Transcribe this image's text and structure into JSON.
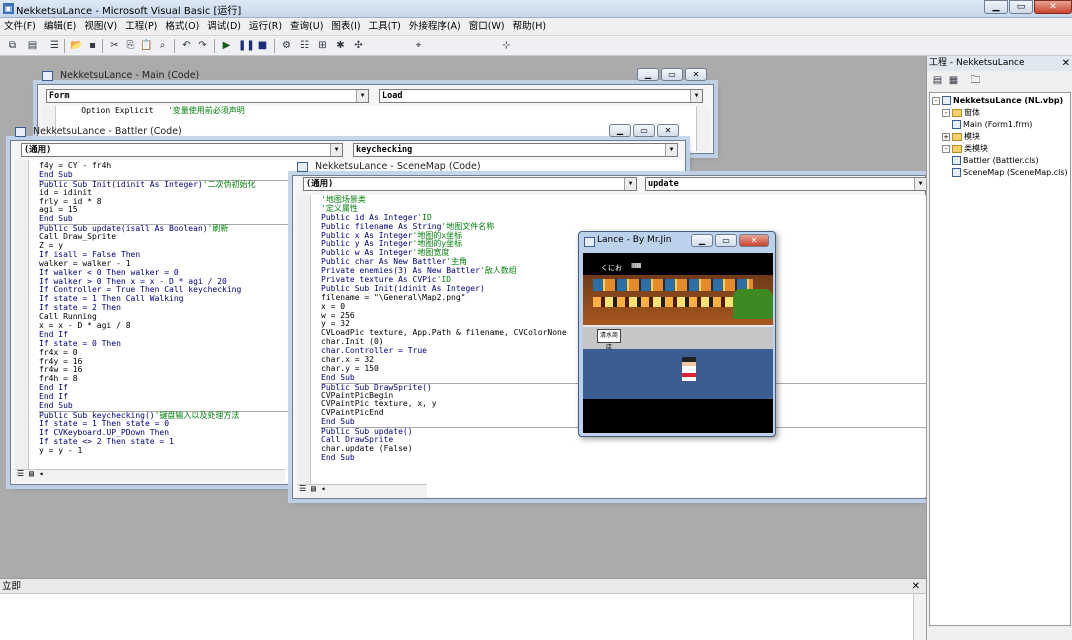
{
  "app": {
    "title": "NekketsuLance - Microsoft Visual Basic [运行]"
  },
  "menu": [
    "文件(F)",
    "编辑(E)",
    "视图(V)",
    "工程(P)",
    "格式(O)",
    "调试(D)",
    "运行(R)",
    "查询(U)",
    "图表(I)",
    "工具(T)",
    "外接程序(A)",
    "窗口(W)",
    "帮助(H)"
  ],
  "windows": {
    "main": {
      "title": "NekketsuLance - Main (Code)",
      "object": "Form",
      "proc": "Load",
      "lines": [
        {
          "t": "    Option Explicit   ",
          "c": "'变量使用前必须声明"
        }
      ]
    },
    "battler": {
      "title": "NekketsuLance - Battler (Code)",
      "object": "(通用)",
      "proc": "keychecking",
      "lines": [
        {
          "t": "f4y = CY - fr4h"
        },
        {
          "t": "End Sub",
          "k": 1
        },
        {
          "t": "Public Sub Init(idinit As Integer)",
          "k": 1,
          "c": "'二次伪初始化"
        },
        {
          "t": "id = idinit"
        },
        {
          "t": "frly = id * 8"
        },
        {
          "t": "agi = 15"
        },
        {
          "t": "End Sub",
          "k": 1
        },
        {
          "t": "Public Sub update(isall As Boolean)",
          "k": 1,
          "c": "'刷新"
        },
        {
          "t": "Call Draw_Sprite"
        },
        {
          "t": "Z = y"
        },
        {
          "t": "If isall = False Then",
          "k": 1
        },
        {
          "t": "walker = walker - 1"
        },
        {
          "t": "If walker < 0 Then walker = 0",
          "k": 1
        },
        {
          "t": "If walker > 0 Then x = x - D * agi / 20",
          "k": 1
        },
        {
          "t": "If Controller = True Then Call keychecking",
          "k": 1
        },
        {
          "t": "If state = 1 Then Call Walking",
          "k": 1
        },
        {
          "t": "If state = 2 Then",
          "k": 1
        },
        {
          "t": "Call Running"
        },
        {
          "t": "x = x - D * agi / 8"
        },
        {
          "t": "End If",
          "k": 1
        },
        {
          "t": "If state = 0 Then",
          "k": 1
        },
        {
          "t": "fr4x = 0"
        },
        {
          "t": "fr4y = 16"
        },
        {
          "t": "fr4w = 16"
        },
        {
          "t": "fr4h = 8"
        },
        {
          "t": "End If",
          "k": 1
        },
        {
          "t": "End If",
          "k": 1
        },
        {
          "t": "End Sub",
          "k": 1
        },
        {
          "t": "Public Sub keychecking()",
          "k": 1,
          "c": "'键盘输入以及处理方法"
        },
        {
          "t": "If state = 1 Then state = 0",
          "k": 1
        },
        {
          "t": "If CVKeyboard.UP_PDown Then",
          "k": 1
        },
        {
          "t": "If state <> 2 Then state = 1",
          "k": 1
        },
        {
          "t": "y = y - 1"
        }
      ]
    },
    "scene": {
      "title": "NekketsuLance - SceneMap (Code)",
      "object": "(通用)",
      "proc": "update",
      "lines": [
        {
          "t": "",
          "c": "'地图场景类"
        },
        {
          "t": "",
          "c": "'定义属性"
        },
        {
          "t": "Public id As Integer",
          "k": 1,
          "c": "'ID"
        },
        {
          "t": "Public filename As String",
          "k": 1,
          "c": "'地图文件名称"
        },
        {
          "t": "Public x As Integer",
          "k": 1,
          "c": "'地图的x坐标"
        },
        {
          "t": "Public y As Integer",
          "k": 1,
          "c": "'地图的y坐标"
        },
        {
          "t": "Public w As Integer",
          "k": 1,
          "c": "'地图宽度"
        },
        {
          "t": "Public char As New Battler",
          "k": 1,
          "c": "'主角"
        },
        {
          "t": "Private enemies(3) As New Battler",
          "k": 1,
          "c": "'敌人数组"
        },
        {
          "t": "Private texture As CVPic",
          "k": 1,
          "c": "'ID"
        },
        {
          "t": "Public Sub Init(idinit As Integer)",
          "k": 1
        },
        {
          "t": "filename = \"\\General\\Map2.png\""
        },
        {
          "t": "x = 0"
        },
        {
          "t": "w = 256"
        },
        {
          "t": "y = 32"
        },
        {
          "t": "CVLoadPic texture, App.Path & filename, CVColorNone"
        },
        {
          "t": "char.Init (0)"
        },
        {
          "t": "char.Controller = True",
          "k": 1
        },
        {
          "t": "char.x = 32"
        },
        {
          "t": "char.y = 150"
        },
        {
          "t": "End Sub",
          "k": 1
        },
        {
          "t": "Public Sub DrawSprite()",
          "k": 1
        },
        {
          "t": "CVPaintPicBegin"
        },
        {
          "t": "CVPaintPic texture, x, y"
        },
        {
          "t": "CVPaintPicEnd"
        },
        {
          "t": "End Sub",
          "k": 1
        },
        {
          "t": "Public Sub update()",
          "k": 1
        },
        {
          "t": "Call DrawSprite",
          "k": 1
        },
        {
          "t": "char.update (False)"
        },
        {
          "t": "End Sub",
          "k": 1
        }
      ]
    }
  },
  "game": {
    "title": "Lance - By Mr.Jin",
    "hud_label": "くにお",
    "hud_bar": "IIIIIIIII",
    "sign": "清水商店"
  },
  "immediate": {
    "title": "立即"
  },
  "project": {
    "title": "工程 - NekketsuLance",
    "tree": [
      {
        "label": "NekketsuLance (NL.vbp)",
        "bold": true,
        "indent": 0,
        "icon": "project",
        "pm": "-"
      },
      {
        "label": "窗体",
        "indent": 1,
        "icon": "folder",
        "pm": "-"
      },
      {
        "label": "Main (Form1.frm)",
        "indent": 2,
        "icon": "form"
      },
      {
        "label": "模块",
        "indent": 1,
        "icon": "folder",
        "pm": "+"
      },
      {
        "label": "类模块",
        "indent": 1,
        "icon": "folder",
        "pm": "-"
      },
      {
        "label": "Battler (Battler.cls)",
        "indent": 2,
        "icon": "class"
      },
      {
        "label": "SceneMap (SceneMap.cls)",
        "indent": 2,
        "icon": "class"
      }
    ]
  }
}
